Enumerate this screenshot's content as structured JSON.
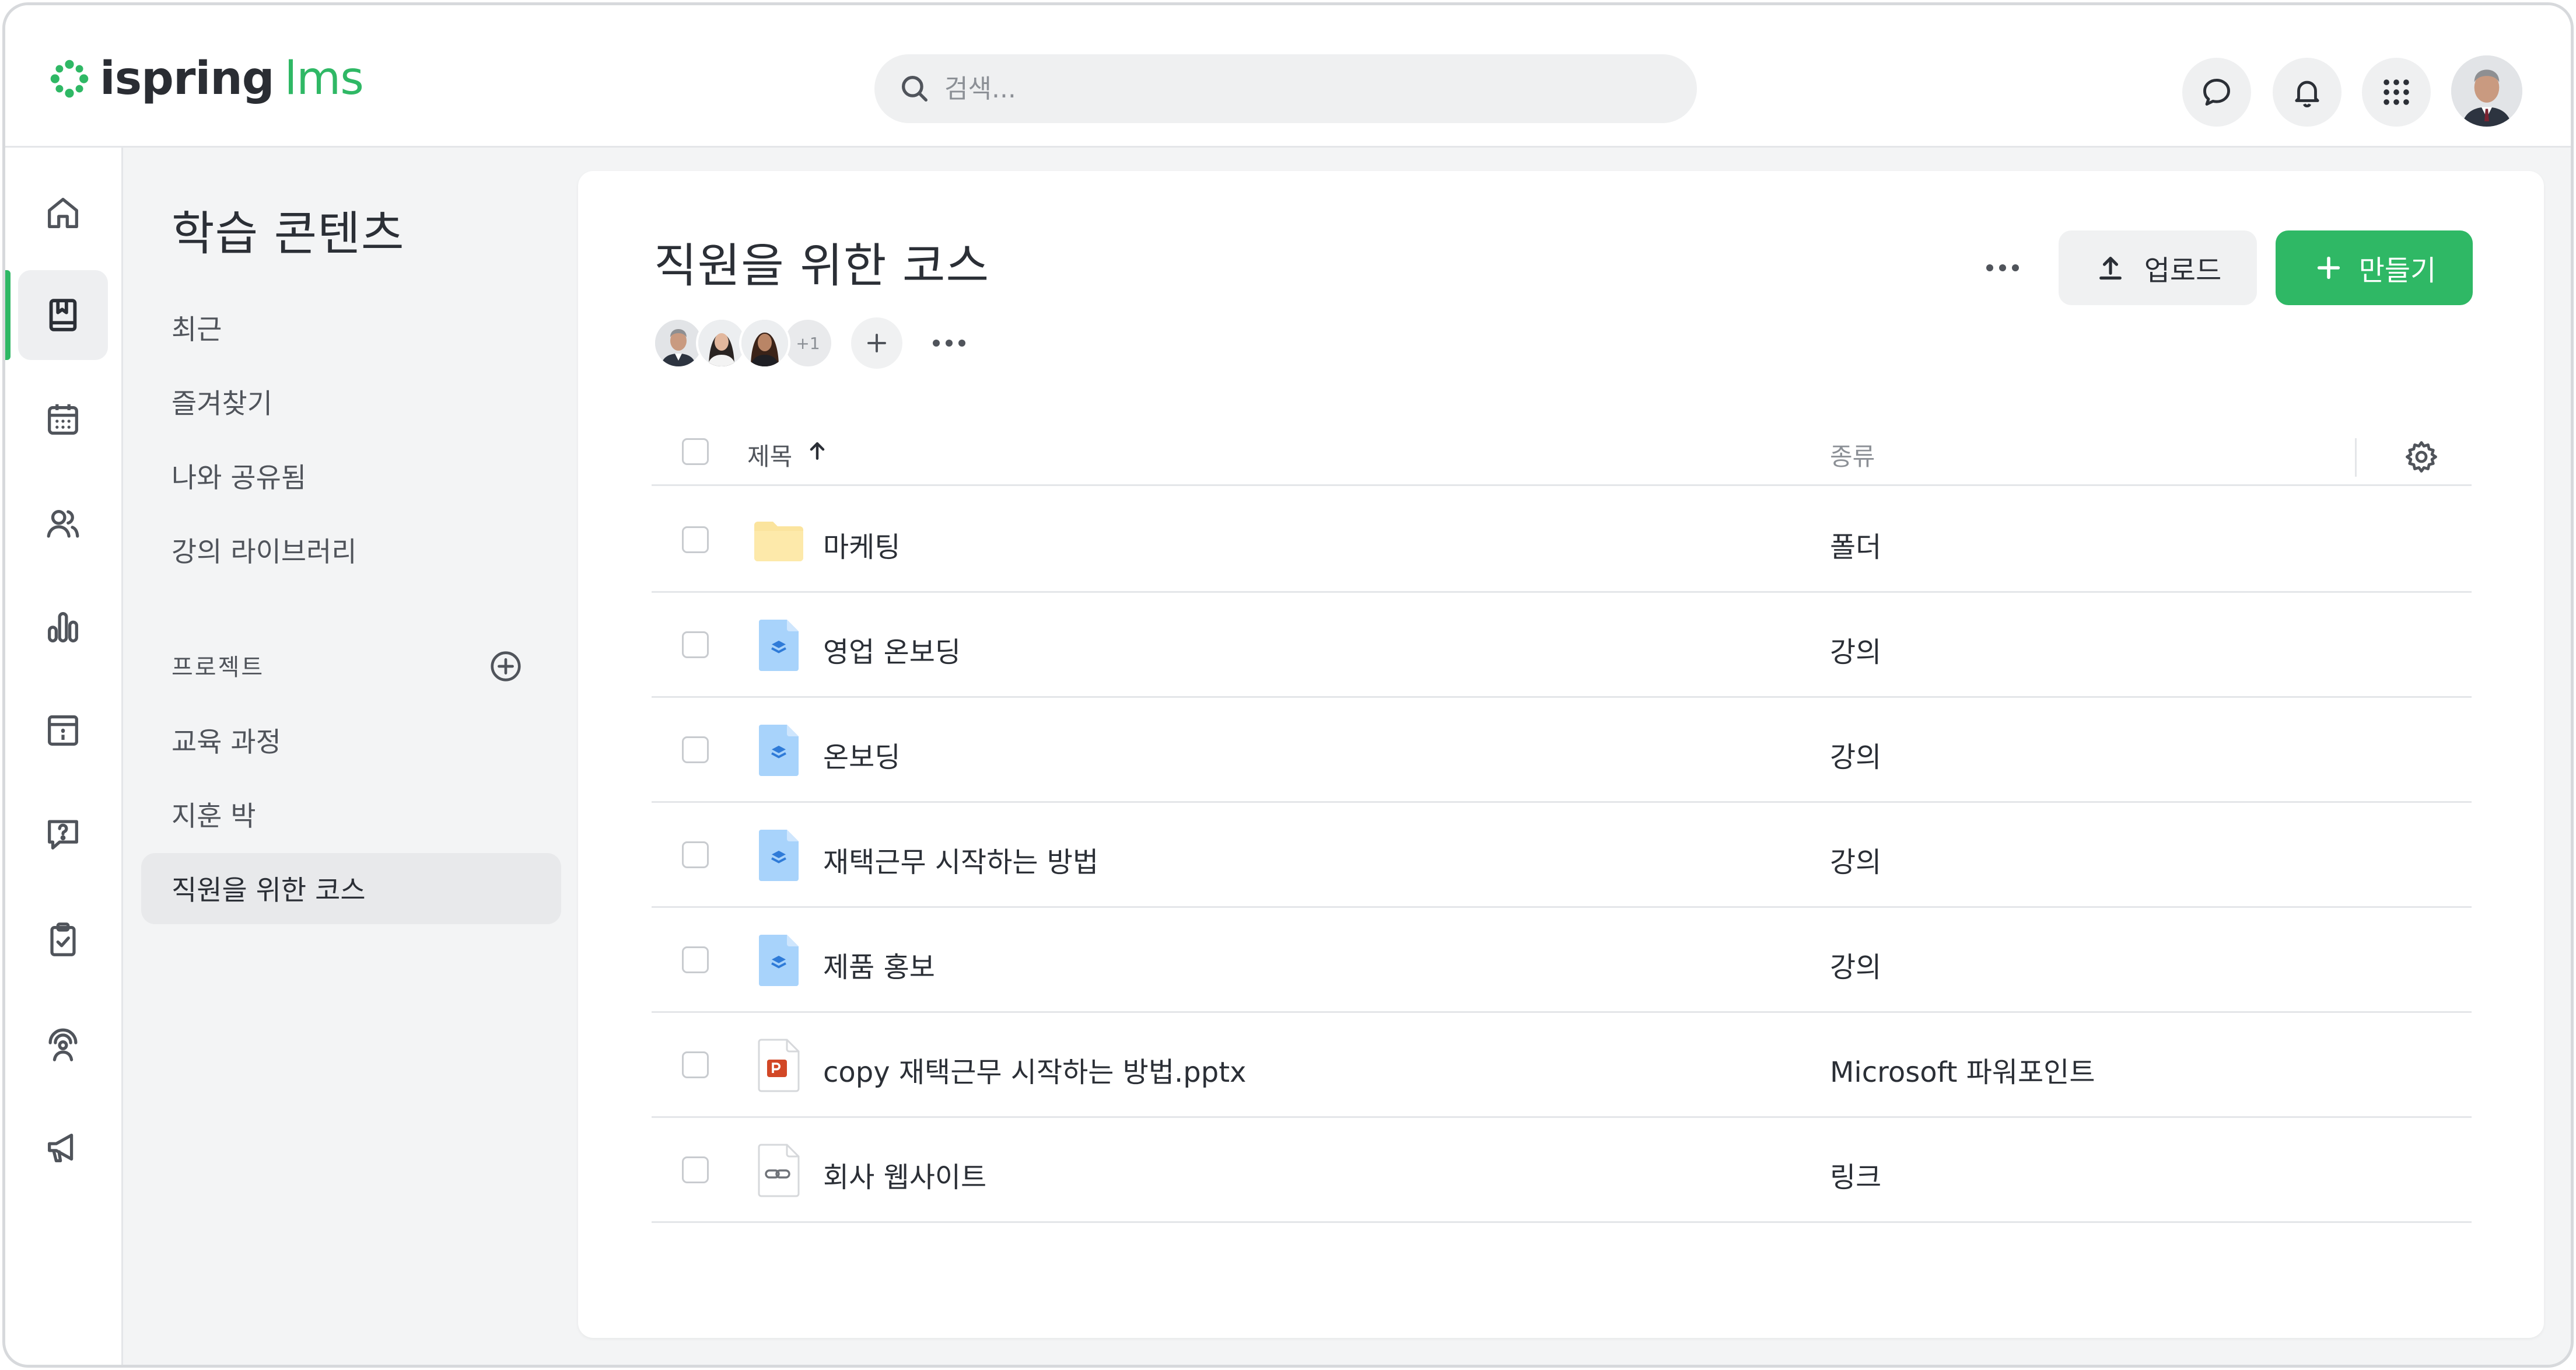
{
  "brand": {
    "name": "ispring",
    "suffix": "lms",
    "accent": "#2fb865"
  },
  "search": {
    "placeholder": "검색..."
  },
  "topbar": {
    "icons": [
      "chat-icon",
      "bell-icon",
      "apps-grid-icon",
      "user-avatar"
    ]
  },
  "rail": {
    "items": [
      "home-icon",
      "content-book-icon",
      "calendar-icon",
      "users-icon",
      "reports-chart-icon",
      "info-board-icon",
      "help-question-icon",
      "tasks-clipboard-icon",
      "coach-icon",
      "announcements-megaphone-icon"
    ],
    "active_index": 1
  },
  "sidebar": {
    "title": "학습 콘텐츠",
    "links": [
      "최근",
      "즐겨찾기",
      "나와 공유됨",
      "강의 라이브러리"
    ],
    "section_label": "프로젝트",
    "projects": [
      "교육 과정",
      "지훈 박",
      "직원을 위한 코스"
    ],
    "selected_project": "직원을 위한 코스"
  },
  "main": {
    "title": "직원을 위한 코스",
    "upload_label": "업로드",
    "create_label": "만들기",
    "members_extra": "+1",
    "columns": {
      "title": "제목",
      "type": "종류"
    },
    "rows": [
      {
        "name": "마케팅",
        "type": "폴더",
        "icon": "folder-icon"
      },
      {
        "name": "영업 온보딩",
        "type": "강의",
        "icon": "course-file-icon"
      },
      {
        "name": "온보딩",
        "type": "강의",
        "icon": "course-file-icon"
      },
      {
        "name": "재택근무 시작하는 방법",
        "type": "강의",
        "icon": "course-file-icon"
      },
      {
        "name": "제품 홍보",
        "type": "강의",
        "icon": "course-file-icon"
      },
      {
        "name": "copy 재택근무 시작하는 방법.pptx",
        "type": "Microsoft 파워포인트",
        "icon": "powerpoint-file-icon"
      },
      {
        "name": "회사 웹사이트",
        "type": "링크",
        "icon": "link-file-icon"
      }
    ]
  }
}
